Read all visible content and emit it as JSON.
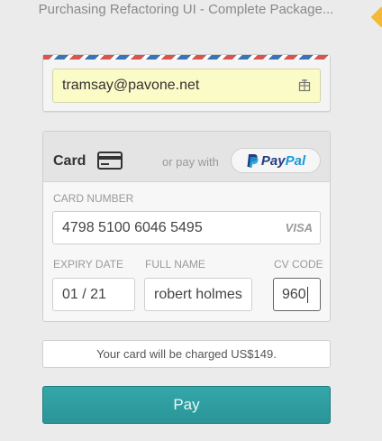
{
  "product_title": "Purchasing Refactoring UI - Complete Package...",
  "email": {
    "value": "tramsay@pavone.net"
  },
  "card": {
    "label": "Card",
    "or_pay_with": "or pay with",
    "paypal": {
      "part1": "Pay",
      "part2": "Pal"
    },
    "number_label": "CARD NUMBER",
    "number_value": "4798 5100 6046 5495",
    "brand": "VISA",
    "expiry_label": "EXPIRY DATE",
    "expiry_value": "01 / 21",
    "name_label": "FULL NAME",
    "name_value": "robert holmes",
    "cvc_label": "CV CODE",
    "cvc_value": "960"
  },
  "charge_text": "Your card will be charged US$149.",
  "pay_label": "Pay",
  "colors": {
    "accent": "#2a9598",
    "email_bg": "#fbfbc8",
    "diamond": "#f5b93a"
  }
}
